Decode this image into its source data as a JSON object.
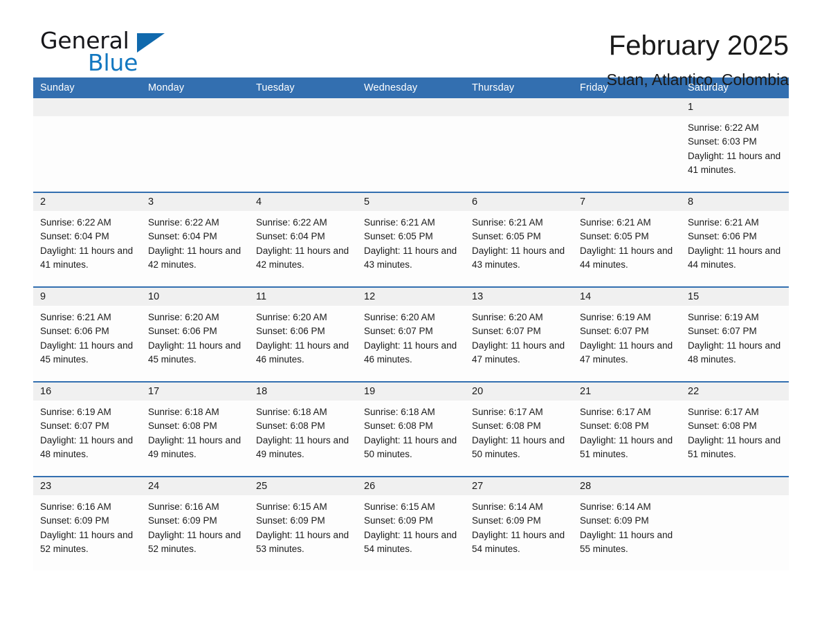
{
  "brand": {
    "name_part1": "General",
    "name_part2": "Blue",
    "flag_icon": "triangle-flag-icon",
    "accent_color": "#1069ad"
  },
  "header": {
    "month_title": "February 2025",
    "location": "Suan, Atlantico, Colombia"
  },
  "calendar": {
    "header_bg": "#336fb0",
    "daynum_bg": "#f0f0f0",
    "weekday_headers": [
      "Sunday",
      "Monday",
      "Tuesday",
      "Wednesday",
      "Thursday",
      "Friday",
      "Saturday"
    ],
    "weeks": [
      [
        {
          "day": "",
          "sunrise": "",
          "sunset": "",
          "daylight": "",
          "empty": true
        },
        {
          "day": "",
          "sunrise": "",
          "sunset": "",
          "daylight": "",
          "empty": true
        },
        {
          "day": "",
          "sunrise": "",
          "sunset": "",
          "daylight": "",
          "empty": true
        },
        {
          "day": "",
          "sunrise": "",
          "sunset": "",
          "daylight": "",
          "empty": true
        },
        {
          "day": "",
          "sunrise": "",
          "sunset": "",
          "daylight": "",
          "empty": true
        },
        {
          "day": "",
          "sunrise": "",
          "sunset": "",
          "daylight": "",
          "empty": true
        },
        {
          "day": "1",
          "sunrise": "Sunrise: 6:22 AM",
          "sunset": "Sunset: 6:03 PM",
          "daylight": "Daylight: 11 hours and 41 minutes.",
          "empty": false
        }
      ],
      [
        {
          "day": "2",
          "sunrise": "Sunrise: 6:22 AM",
          "sunset": "Sunset: 6:04 PM",
          "daylight": "Daylight: 11 hours and 41 minutes.",
          "empty": false
        },
        {
          "day": "3",
          "sunrise": "Sunrise: 6:22 AM",
          "sunset": "Sunset: 6:04 PM",
          "daylight": "Daylight: 11 hours and 42 minutes.",
          "empty": false
        },
        {
          "day": "4",
          "sunrise": "Sunrise: 6:22 AM",
          "sunset": "Sunset: 6:04 PM",
          "daylight": "Daylight: 11 hours and 42 minutes.",
          "empty": false
        },
        {
          "day": "5",
          "sunrise": "Sunrise: 6:21 AM",
          "sunset": "Sunset: 6:05 PM",
          "daylight": "Daylight: 11 hours and 43 minutes.",
          "empty": false
        },
        {
          "day": "6",
          "sunrise": "Sunrise: 6:21 AM",
          "sunset": "Sunset: 6:05 PM",
          "daylight": "Daylight: 11 hours and 43 minutes.",
          "empty": false
        },
        {
          "day": "7",
          "sunrise": "Sunrise: 6:21 AM",
          "sunset": "Sunset: 6:05 PM",
          "daylight": "Daylight: 11 hours and 44 minutes.",
          "empty": false
        },
        {
          "day": "8",
          "sunrise": "Sunrise: 6:21 AM",
          "sunset": "Sunset: 6:06 PM",
          "daylight": "Daylight: 11 hours and 44 minutes.",
          "empty": false
        }
      ],
      [
        {
          "day": "9",
          "sunrise": "Sunrise: 6:21 AM",
          "sunset": "Sunset: 6:06 PM",
          "daylight": "Daylight: 11 hours and 45 minutes.",
          "empty": false
        },
        {
          "day": "10",
          "sunrise": "Sunrise: 6:20 AM",
          "sunset": "Sunset: 6:06 PM",
          "daylight": "Daylight: 11 hours and 45 minutes.",
          "empty": false
        },
        {
          "day": "11",
          "sunrise": "Sunrise: 6:20 AM",
          "sunset": "Sunset: 6:06 PM",
          "daylight": "Daylight: 11 hours and 46 minutes.",
          "empty": false
        },
        {
          "day": "12",
          "sunrise": "Sunrise: 6:20 AM",
          "sunset": "Sunset: 6:07 PM",
          "daylight": "Daylight: 11 hours and 46 minutes.",
          "empty": false
        },
        {
          "day": "13",
          "sunrise": "Sunrise: 6:20 AM",
          "sunset": "Sunset: 6:07 PM",
          "daylight": "Daylight: 11 hours and 47 minutes.",
          "empty": false
        },
        {
          "day": "14",
          "sunrise": "Sunrise: 6:19 AM",
          "sunset": "Sunset: 6:07 PM",
          "daylight": "Daylight: 11 hours and 47 minutes.",
          "empty": false
        },
        {
          "day": "15",
          "sunrise": "Sunrise: 6:19 AM",
          "sunset": "Sunset: 6:07 PM",
          "daylight": "Daylight: 11 hours and 48 minutes.",
          "empty": false
        }
      ],
      [
        {
          "day": "16",
          "sunrise": "Sunrise: 6:19 AM",
          "sunset": "Sunset: 6:07 PM",
          "daylight": "Daylight: 11 hours and 48 minutes.",
          "empty": false
        },
        {
          "day": "17",
          "sunrise": "Sunrise: 6:18 AM",
          "sunset": "Sunset: 6:08 PM",
          "daylight": "Daylight: 11 hours and 49 minutes.",
          "empty": false
        },
        {
          "day": "18",
          "sunrise": "Sunrise: 6:18 AM",
          "sunset": "Sunset: 6:08 PM",
          "daylight": "Daylight: 11 hours and 49 minutes.",
          "empty": false
        },
        {
          "day": "19",
          "sunrise": "Sunrise: 6:18 AM",
          "sunset": "Sunset: 6:08 PM",
          "daylight": "Daylight: 11 hours and 50 minutes.",
          "empty": false
        },
        {
          "day": "20",
          "sunrise": "Sunrise: 6:17 AM",
          "sunset": "Sunset: 6:08 PM",
          "daylight": "Daylight: 11 hours and 50 minutes.",
          "empty": false
        },
        {
          "day": "21",
          "sunrise": "Sunrise: 6:17 AM",
          "sunset": "Sunset: 6:08 PM",
          "daylight": "Daylight: 11 hours and 51 minutes.",
          "empty": false
        },
        {
          "day": "22",
          "sunrise": "Sunrise: 6:17 AM",
          "sunset": "Sunset: 6:08 PM",
          "daylight": "Daylight: 11 hours and 51 minutes.",
          "empty": false
        }
      ],
      [
        {
          "day": "23",
          "sunrise": "Sunrise: 6:16 AM",
          "sunset": "Sunset: 6:09 PM",
          "daylight": "Daylight: 11 hours and 52 minutes.",
          "empty": false
        },
        {
          "day": "24",
          "sunrise": "Sunrise: 6:16 AM",
          "sunset": "Sunset: 6:09 PM",
          "daylight": "Daylight: 11 hours and 52 minutes.",
          "empty": false
        },
        {
          "day": "25",
          "sunrise": "Sunrise: 6:15 AM",
          "sunset": "Sunset: 6:09 PM",
          "daylight": "Daylight: 11 hours and 53 minutes.",
          "empty": false
        },
        {
          "day": "26",
          "sunrise": "Sunrise: 6:15 AM",
          "sunset": "Sunset: 6:09 PM",
          "daylight": "Daylight: 11 hours and 54 minutes.",
          "empty": false
        },
        {
          "day": "27",
          "sunrise": "Sunrise: 6:14 AM",
          "sunset": "Sunset: 6:09 PM",
          "daylight": "Daylight: 11 hours and 54 minutes.",
          "empty": false
        },
        {
          "day": "28",
          "sunrise": "Sunrise: 6:14 AM",
          "sunset": "Sunset: 6:09 PM",
          "daylight": "Daylight: 11 hours and 55 minutes.",
          "empty": false
        },
        {
          "day": "",
          "sunrise": "",
          "sunset": "",
          "daylight": "",
          "empty": true
        }
      ]
    ]
  }
}
